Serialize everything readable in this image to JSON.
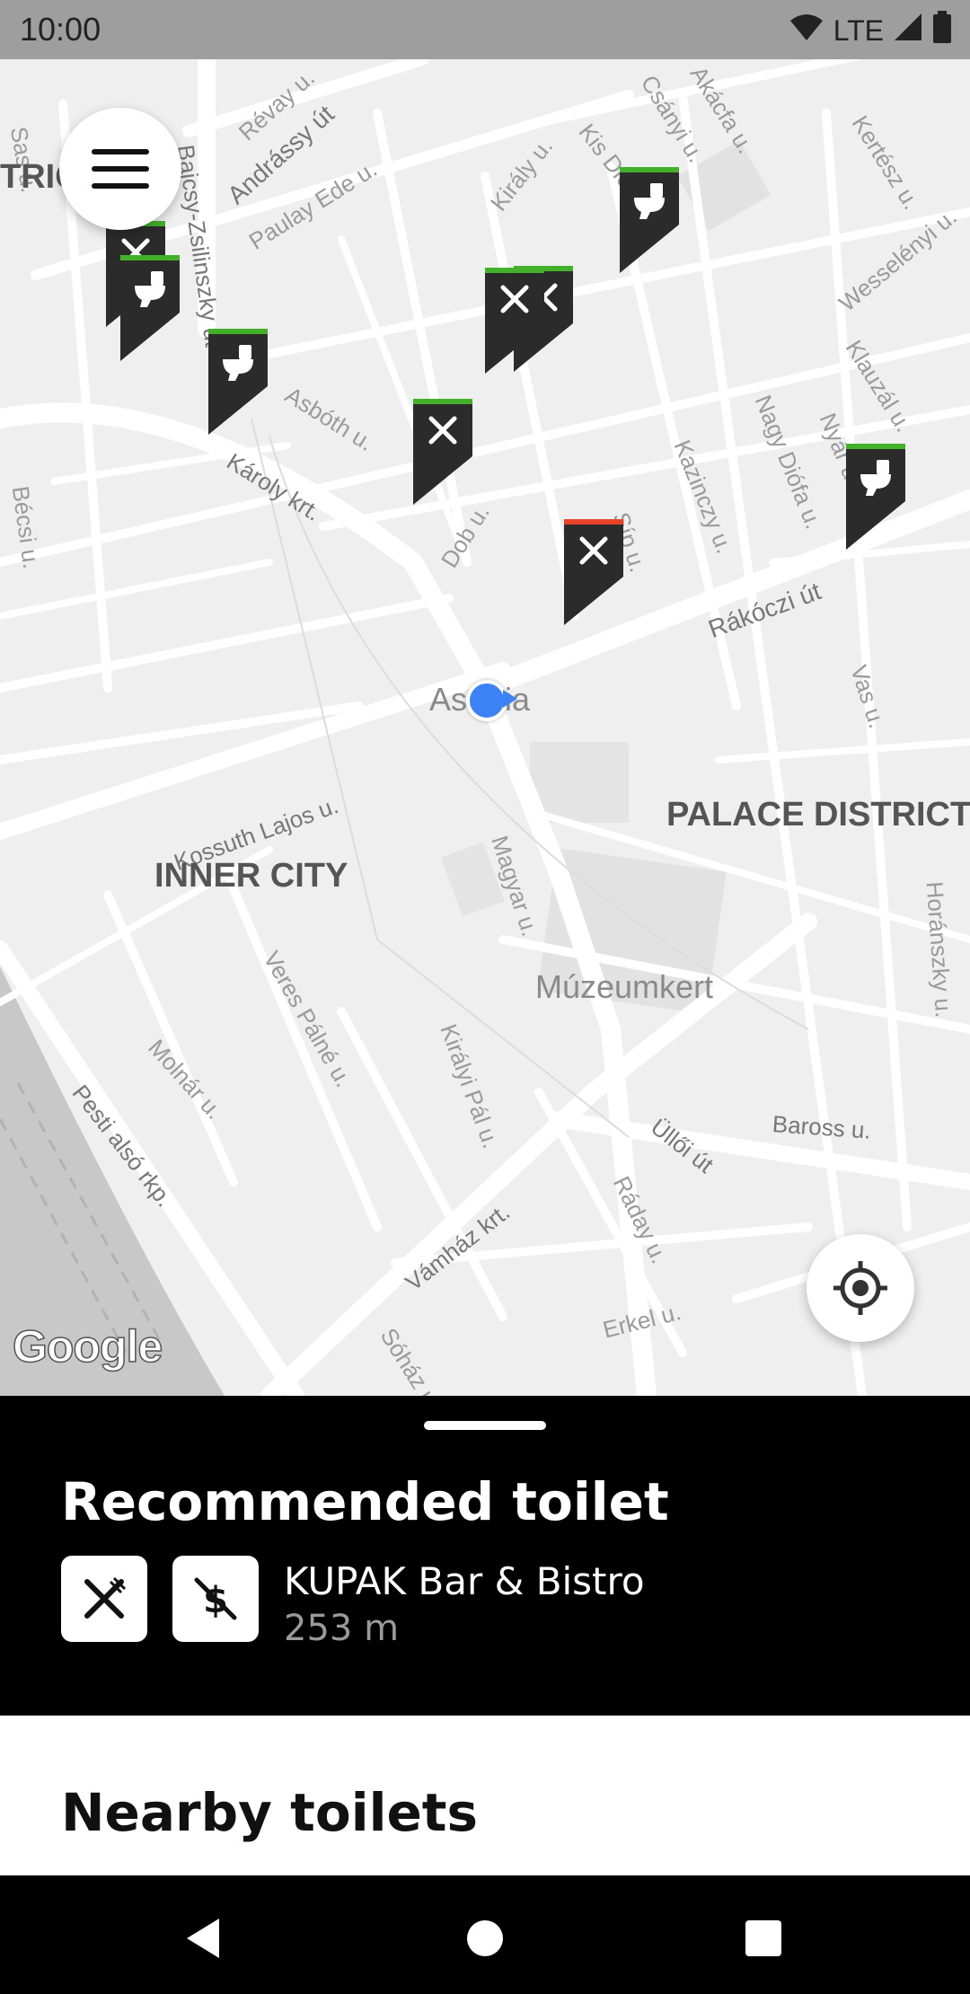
{
  "status_bar": {
    "time": "10:00",
    "network": "LTE",
    "icons": [
      "wifi-icon",
      "cell-signal-icon",
      "battery-icon"
    ]
  },
  "map": {
    "districts": [
      "INNER CITY",
      "PALACE DISTRICT",
      "TRIC"
    ],
    "streets": [
      "Sas u.",
      "Révay u.",
      "Andrássy út",
      "Bajcsy-Zsilinszky út",
      "Paulay Ede u.",
      "Király u.",
      "Kis Diófa",
      "Csányi u.",
      "Akácfa u.",
      "Kertész u.",
      "Wesselényi u.",
      "Klauzál u.",
      "Nagy Diófa u.",
      "Nyár u.",
      "Kazinczy u.",
      "Síp u.",
      "Dob u.",
      "Asbóth u.",
      "Károly krt.",
      "Bécsi u.",
      "Rákóczi út",
      "Vas u.",
      "Kossuth Lajos u.",
      "Magyar u.",
      "Horánszky u.",
      "Veres Pálné u.",
      "Királyi Pál u.",
      "Molnár u.",
      "Pesti alsó rkp.",
      "Baross u.",
      "Üllői út",
      "Ráday u.",
      "Vámház krt.",
      "Erkel u.",
      "Sóház u."
    ],
    "places": [
      "Astoria",
      "Múzeumkert"
    ],
    "attribution": "Google",
    "colors": {
      "background": "#efefef",
      "road": "#ffffff",
      "pin": "#2b2b2b",
      "pin_ok": "#43b02a",
      "pin_alert": "#e8442a",
      "location_dot": "#3b82f6"
    }
  },
  "controls": {
    "menu_icon": "hamburger-menu-icon",
    "locate_icon": "my-location-icon"
  },
  "sheet": {
    "title": "Recommended toilet",
    "recommended": {
      "name": "KUPAK Bar & Bistro",
      "distance": "253 m",
      "badges": [
        "restaurant-icon",
        "free-icon"
      ]
    }
  },
  "nearby": {
    "title": "Nearby toilets"
  },
  "nav": {
    "buttons": [
      "back-icon",
      "home-icon",
      "recents-icon"
    ]
  }
}
